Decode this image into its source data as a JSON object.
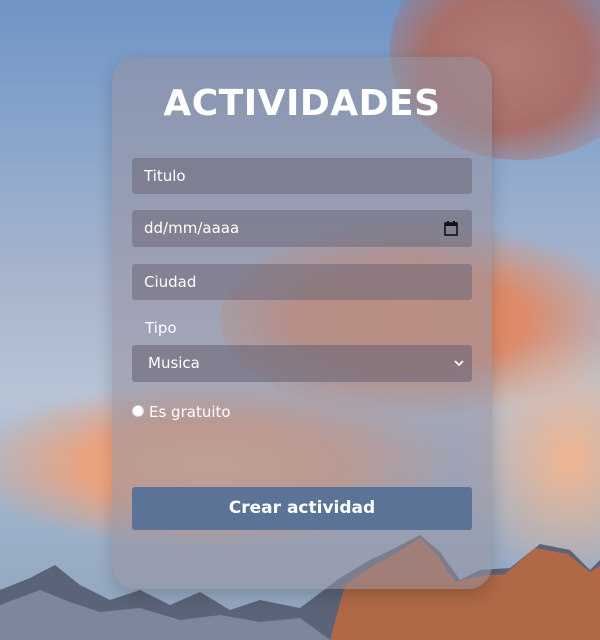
{
  "form": {
    "title": "ACTIVIDADES",
    "titulo_placeholder": "Titulo",
    "fecha_placeholder": "dd/mm/aaaa",
    "ciudad_placeholder": "Ciudad",
    "tipo_label": "Tipo",
    "tipo_selected": "Musica",
    "gratuito_label": "Es gratuito",
    "submit_label": "Crear actividad"
  },
  "icons": {
    "calendar": "calendar-icon",
    "select_arrow": "chevron-down-icon"
  },
  "colors": {
    "submit_button": "#5a7396",
    "text": "#ffffff"
  }
}
